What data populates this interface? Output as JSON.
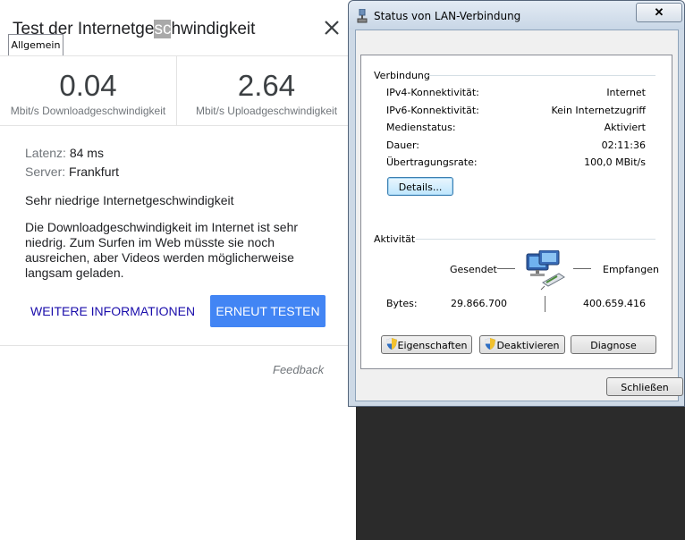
{
  "speedtest": {
    "title_pre": "Test der Internetge",
    "title_hl": "sc",
    "title_post": "hwindigkeit",
    "download_value": "0.04",
    "download_label": "Mbit/s Downloadgeschwindigkeit",
    "upload_value": "2.64",
    "upload_label": "Mbit/s Uploadgeschwindigkeit",
    "latency_label": "Latenz:",
    "latency_value": "84 ms",
    "server_label": "Server:",
    "server_value": "Frankfurt",
    "rating": "Sehr niedrige Internetgeschwindigkeit",
    "description": "Die Downloadgeschwindigkeit im Internet ist sehr niedrig. Zum Surfen im Web müsste sie noch ausreichen, aber Videos werden möglicherweise langsam geladen.",
    "more_link": "WEITERE INFORMATIONEN",
    "retest_button": "ERNEUT TESTEN",
    "feedback": "Feedback",
    "accent_color": "#4285f4"
  },
  "dialog": {
    "title": "Status von LAN-Verbindung",
    "close_glyph": "✕",
    "tab": "Allgemein",
    "connection_group": "Verbindung",
    "rows": [
      {
        "label": "IPv4-Konnektivität:",
        "value": "Internet"
      },
      {
        "label": "IPv6-Konnektivität:",
        "value": "Kein Internetzugriff"
      },
      {
        "label": "Medienstatus:",
        "value": "Aktiviert"
      },
      {
        "label": "Dauer:",
        "value": "02:11:36"
      },
      {
        "label": "Übertragungsrate:",
        "value": "100,0 MBit/s"
      }
    ],
    "details_button": "Details...",
    "activity_group": "Aktivität",
    "sent_label": "Gesendet",
    "received_label": "Empfangen",
    "bytes_label": "Bytes:",
    "bytes_sent": "29.866.700",
    "bytes_received": "400.659.416",
    "properties_button": "Eigenschaften",
    "disable_button": "Deaktivieren",
    "diagnose_button": "Diagnose",
    "close_button": "Schließen",
    "icons": [
      "network-connection-icon",
      "shield-icon",
      "network-computers-icon"
    ]
  }
}
